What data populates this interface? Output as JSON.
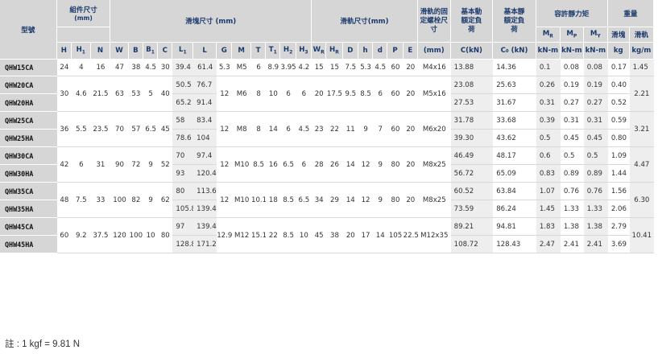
{
  "headers": {
    "model": "型號",
    "assembly": "組件尺寸",
    "assembly_unit": "(mm)",
    "block": "滑塊尺寸 (mm)",
    "rail": "滑軌尺寸(mm)",
    "bolt": "滑軌的固定螺栓尺寸",
    "dynamic": "基本動額定負荷",
    "static": "基本靜額定負荷",
    "moment": "容許靜力矩",
    "weight": "重量",
    "block_w": "滑塊",
    "rail_w": "滑軌",
    "mm": "(mm)",
    "ckn": "C(kN)",
    "c0kn": "C₀ (kN)",
    "knm": "kN-m",
    "kg": "kg",
    "kgm": "kg/m",
    "mr": "M",
    "mr_sub": "R",
    "mp": "M",
    "mp_sub": "P",
    "my": "M",
    "my_sub": "Y",
    "sym_H": "H",
    "sym_H1": "H",
    "sym_H1_sub": "1",
    "sym_N": "N",
    "sym_W": "W",
    "sym_B": "B",
    "sym_B1": "B",
    "sym_B1_sub": "1",
    "sym_C": "C",
    "sym_L1": "L",
    "sym_L1_sub": "1",
    "sym_L": "L",
    "sym_G": "G",
    "sym_M": "M",
    "sym_T": "T",
    "sym_T1": "T",
    "sym_T1_sub": "1",
    "sym_H2": "H",
    "sym_H2_sub": "2",
    "sym_H3": "H",
    "sym_H3_sub": "3",
    "sym_WR": "W",
    "sym_WR_sub": "R",
    "sym_HR": "H",
    "sym_HR_sub": "R",
    "sym_D": "D",
    "sym_h": "h",
    "sym_d": "d",
    "sym_P": "P",
    "sym_E": "E"
  },
  "rows": {
    "r15ca": {
      "model": "QHW15CA",
      "H": "24",
      "H1": "4",
      "N": "16",
      "W": "47",
      "B": "38",
      "B1": "4.5",
      "C": "30",
      "L1": "39.4",
      "L": "61.4",
      "G": "5.3",
      "M": "M5",
      "T": "6",
      "T1": "8.9",
      "H2": "3.95",
      "H3": "4.2",
      "WR": "15",
      "HR": "15",
      "D": "7.5",
      "h": "5.3",
      "d": "4.5",
      "P": "60",
      "E": "20",
      "bolt": "M4x16",
      "C_kn": "13.88",
      "C0": "14.36",
      "MR": "0.1",
      "MP": "0.08",
      "MY": "0.08",
      "kg": "0.17",
      "kgm": "1.45"
    },
    "g20": {
      "H": "30",
      "H1": "4.6",
      "N": "21.5",
      "W": "63",
      "B": "53",
      "B1": "5",
      "C": "40",
      "G": "12",
      "M": "M6",
      "T": "8",
      "T1": "10",
      "H2": "6",
      "H3": "6",
      "WR": "20",
      "HR": "17.5",
      "D": "9.5",
      "h": "8.5",
      "d": "6",
      "P": "60",
      "E": "20",
      "bolt": "M5x16",
      "kgm": "2.21"
    },
    "r20ca": {
      "model": "QHW20CA",
      "L1": "50.5",
      "L": "76.7",
      "C_kn": "23.08",
      "C0": "25.63",
      "MR": "0.26",
      "MP": "0.19",
      "MY": "0.19",
      "kg": "0.40"
    },
    "r20ha": {
      "model": "QHW20HA",
      "L1": "65.2",
      "L": "91.4",
      "C_kn": "27.53",
      "C0": "31.67",
      "MR": "0.31",
      "MP": "0.27",
      "MY": "0.27",
      "kg": "0.52"
    },
    "g25": {
      "H": "36",
      "H1": "5.5",
      "N": "23.5",
      "W": "70",
      "B": "57",
      "B1": "6.5",
      "C": "45",
      "G": "12",
      "M": "M8",
      "T": "8",
      "T1": "14",
      "H2": "6",
      "H3": "4.5",
      "WR": "23",
      "HR": "22",
      "D": "11",
      "h": "9",
      "d": "7",
      "P": "60",
      "E": "20",
      "bolt": "M6x20",
      "kgm": "3.21"
    },
    "r25ca": {
      "model": "QHW25CA",
      "L1": "58",
      "L": "83.4",
      "C_kn": "31.78",
      "C0": "33.68",
      "MR": "0.39",
      "MP": "0.31",
      "MY": "0.31",
      "kg": "0.59"
    },
    "r25ha": {
      "model": "QHW25HA",
      "L1": "78.6",
      "L": "104",
      "C_kn": "39.30",
      "C0": "43.62",
      "MR": "0.5",
      "MP": "0.45",
      "MY": "0.45",
      "kg": "0.80"
    },
    "g30": {
      "H": "42",
      "H1": "6",
      "N": "31",
      "W": "90",
      "B": "72",
      "B1": "9",
      "C": "52",
      "G": "12",
      "M": "M10",
      "T": "8.5",
      "T1": "16",
      "H2": "6.5",
      "H3": "6",
      "WR": "28",
      "HR": "26",
      "D": "14",
      "h": "12",
      "d": "9",
      "P": "80",
      "E": "20",
      "bolt": "M8x25",
      "kgm": "4.47"
    },
    "r30ca": {
      "model": "QHW30CA",
      "L1": "70",
      "L": "97.4",
      "C_kn": "46.49",
      "C0": "48.17",
      "MR": "0.6",
      "MP": "0.5",
      "MY": "0.5",
      "kg": "1.09"
    },
    "r30ha": {
      "model": "QHW30HA",
      "L1": "93",
      "L": "120.4",
      "C_kn": "56.72",
      "C0": "65.09",
      "MR": "0.83",
      "MP": "0.89",
      "MY": "0.89",
      "kg": "1.44"
    },
    "g35": {
      "H": "48",
      "H1": "7.5",
      "N": "33",
      "W": "100",
      "B": "82",
      "B1": "9",
      "C": "62",
      "G": "12",
      "M": "M10",
      "T": "10.1",
      "T1": "18",
      "H2": "8.5",
      "H3": "6.5",
      "WR": "34",
      "HR": "29",
      "D": "14",
      "h": "12",
      "d": "9",
      "P": "80",
      "E": "20",
      "bolt": "M8x25",
      "kgm": "6.30"
    },
    "r35ca": {
      "model": "QHW35CA",
      "L1": "80",
      "L": "113.6",
      "C_kn": "60.52",
      "C0": "63.84",
      "MR": "1.07",
      "MP": "0.76",
      "MY": "0.76",
      "kg": "1.56"
    },
    "r35ha": {
      "model": "QHW35HA",
      "L1": "105.8",
      "L": "139.4",
      "C_kn": "73.59",
      "C0": "86.24",
      "MR": "1.45",
      "MP": "1.33",
      "MY": "1.33",
      "kg": "2.06"
    },
    "g45": {
      "H": "60",
      "H1": "9.2",
      "N": "37.5",
      "W": "120",
      "B": "100",
      "B1": "10",
      "C": "80",
      "G": "12.9",
      "M": "M12",
      "T": "15.1",
      "T1": "22",
      "H2": "8.5",
      "H3": "10",
      "WR": "45",
      "HR": "38",
      "D": "20",
      "h": "17",
      "d": "14",
      "P": "105",
      "E": "22.5",
      "bolt": "M12x35",
      "kgm": "10.41"
    },
    "r45ca": {
      "model": "QHW45CA",
      "L1": "97",
      "L": "139.4",
      "C_kn": "89.21",
      "C0": "94.81",
      "MR": "1.83",
      "MP": "1.38",
      "MY": "1.38",
      "kg": "2.79"
    },
    "r45ha": {
      "model": "QHW45HA",
      "L1": "128.8",
      "L": "171.2",
      "C_kn": "108.72",
      "C0": "128.43",
      "MR": "2.47",
      "MP": "2.41",
      "MY": "2.41",
      "kg": "3.69"
    }
  },
  "note": "註 : 1 kgf = 9.81 N"
}
